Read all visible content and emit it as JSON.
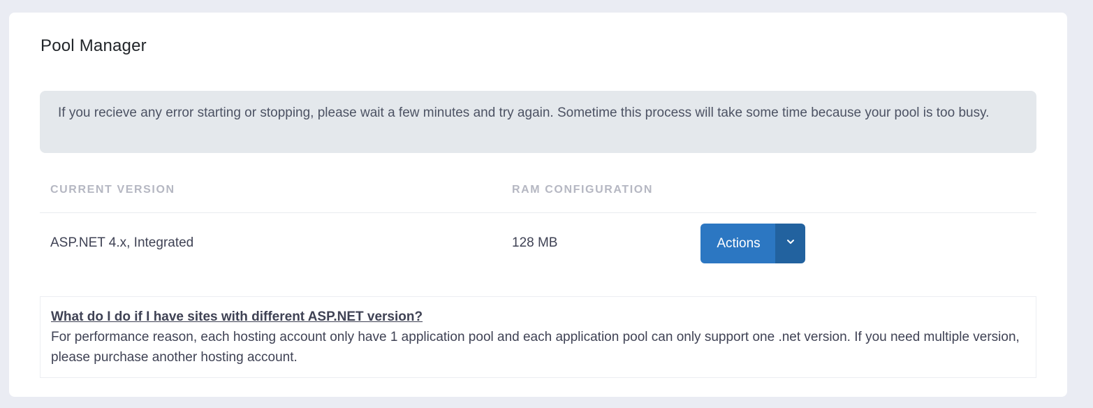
{
  "card": {
    "title": "Pool Manager"
  },
  "alert": {
    "text": "If you recieve any error starting or stopping, please wait a few minutes and try again. Sometime this process will take some time because your pool is too busy."
  },
  "table": {
    "headers": [
      "CURRENT VERSION",
      "RAM CONFIGURATION"
    ],
    "rows": [
      {
        "version": "ASP.NET 4.x, Integrated",
        "ram": "128 MB"
      }
    ],
    "actions_label": "Actions",
    "actions_caret_icon": "chevron-down-icon"
  },
  "faq": {
    "question": "What do I do if I have sites with different ASP.NET version?",
    "answer": "For performance reason, each hosting account only have 1 application pool and each application pool can only support one .net version. If you need multiple version, please purchase another hosting account."
  },
  "colors": {
    "background": "#eaecf3",
    "alert_bg": "#e4e8ec",
    "primary_button": "#2c77c2",
    "primary_button_dark": "#22629f",
    "header_text": "#b5b7c2"
  }
}
